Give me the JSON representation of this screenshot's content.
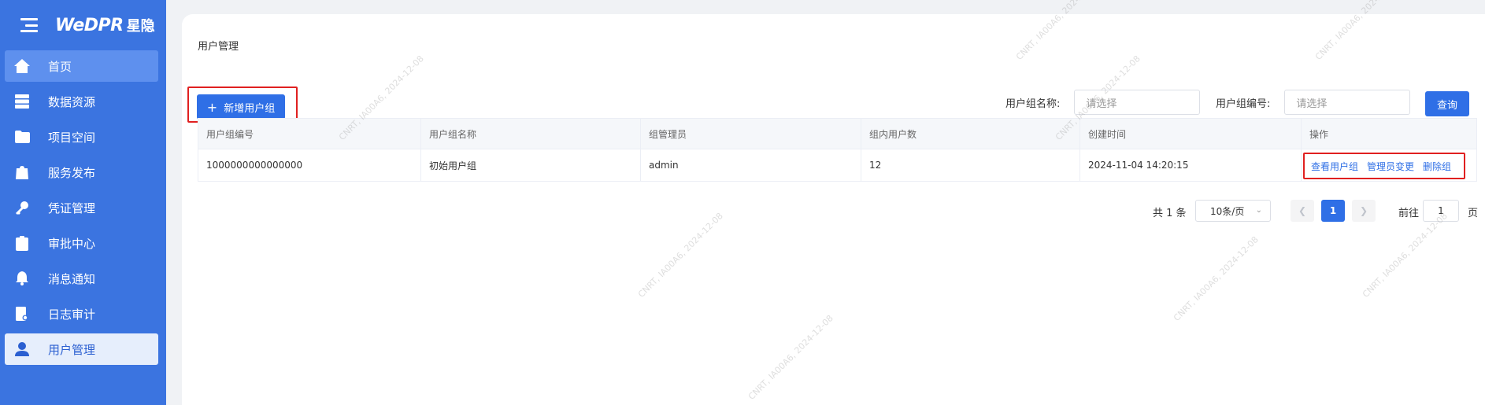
{
  "sidebar": {
    "logo_text": "WeDPR",
    "logo_cn": "星隐",
    "items": [
      {
        "label": "首页",
        "icon": "home-icon"
      },
      {
        "label": "数据资源",
        "icon": "database-icon"
      },
      {
        "label": "项目空间",
        "icon": "folder-icon"
      },
      {
        "label": "服务发布",
        "icon": "bag-icon"
      },
      {
        "label": "凭证管理",
        "icon": "key-icon"
      },
      {
        "label": "审批中心",
        "icon": "clipboard-icon"
      },
      {
        "label": "消息通知",
        "icon": "bell-icon"
      },
      {
        "label": "日志审计",
        "icon": "log-icon"
      },
      {
        "label": "用户管理",
        "icon": "user-icon"
      }
    ]
  },
  "page": {
    "title": "用户管理"
  },
  "toolbar": {
    "add_label": "新增用户组",
    "filter_name_label": "用户组名称:",
    "filter_name_placeholder": "请选择",
    "filter_id_label": "用户组编号:",
    "filter_id_placeholder": "请选择",
    "search_label": "查询"
  },
  "table": {
    "columns": [
      "用户组编号",
      "用户组名称",
      "组管理员",
      "组内用户数",
      "创建时间",
      "操作"
    ],
    "rows": [
      {
        "id": "1000000000000000",
        "name": "初始用户组",
        "admin": "admin",
        "count": "12",
        "created": "2024-11-04 14:20:15",
        "ops": [
          "查看用户组",
          "管理员变更",
          "删除组"
        ]
      }
    ]
  },
  "pagination": {
    "total": "共 1 条",
    "page_size": "10条/页",
    "current": "1",
    "goto_label": "前往",
    "goto_value": "1",
    "page_suffix": "页"
  },
  "watermark": "CNRT, IA00A6, 2024-12-08",
  "colors": {
    "sidebar": "#3b74e0",
    "primary": "#2f6fe6",
    "highlight_box": "#e02020"
  }
}
